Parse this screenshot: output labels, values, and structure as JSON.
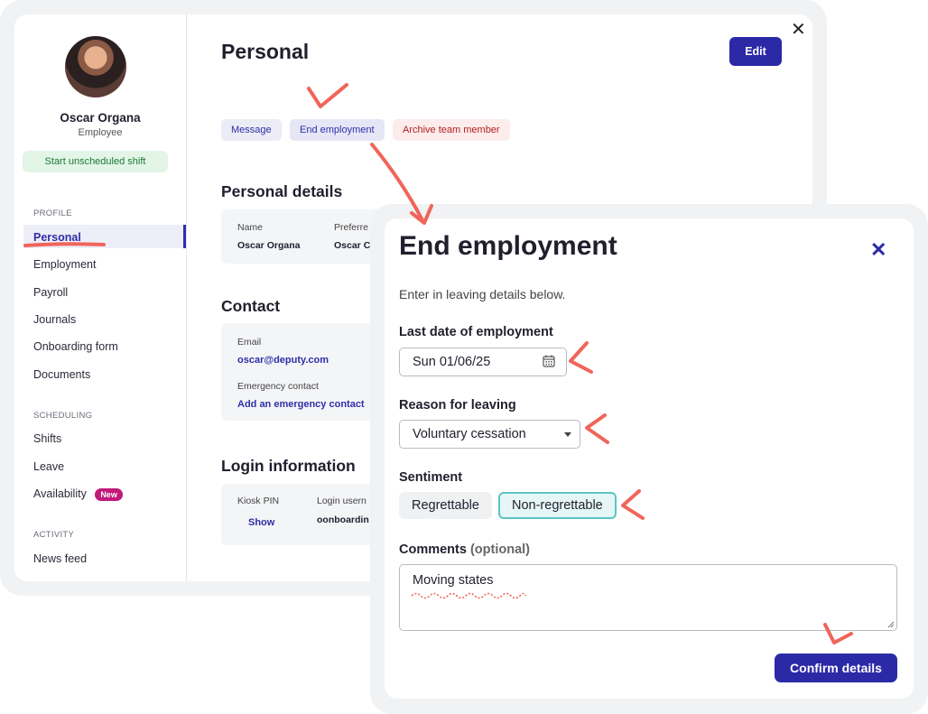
{
  "profile": {
    "name": "Oscar Organa",
    "role": "Employee",
    "start_shift_label": "Start unscheduled shift"
  },
  "sidebar": {
    "sections": {
      "profile": "PROFILE",
      "scheduling": "SCHEDULING",
      "activity": "ACTIVITY"
    },
    "items": {
      "personal": "Personal",
      "employment": "Employment",
      "payroll": "Payroll",
      "journals": "Journals",
      "onboarding": "Onboarding form",
      "documents": "Documents",
      "shifts": "Shifts",
      "leave": "Leave",
      "availability": "Availability",
      "availability_badge": "New",
      "news_feed": "News feed"
    }
  },
  "main": {
    "title": "Personal",
    "edit_label": "Edit",
    "close_glyph": "✕",
    "actions": {
      "message": "Message",
      "end_employment": "End employment",
      "archive": "Archive team member"
    },
    "personal_details": {
      "title": "Personal details",
      "name_label": "Name",
      "name_value": "Oscar Organa",
      "preferred_label": "Preferre",
      "preferred_value": "Oscar C"
    },
    "contact": {
      "title": "Contact",
      "email_label": "Email",
      "email_value": "oscar@deputy.com",
      "emergency_label": "Emergency contact",
      "emergency_link": "Add an emergency contact"
    },
    "login": {
      "title": "Login information",
      "kiosk_label": "Kiosk PIN",
      "kiosk_link": "Show",
      "username_label": "Login usern",
      "username_value": "oonboardin"
    }
  },
  "modal": {
    "title": "End employment",
    "close_glyph": "✕",
    "subtitle": "Enter in leaving details below.",
    "last_date_label": "Last date of employment",
    "last_date_value": "Sun 01/06/25",
    "reason_label": "Reason for leaving",
    "reason_value": "Voluntary cessation",
    "sentiment_label": "Sentiment",
    "sentiment_options": [
      "Regrettable",
      "Non-regrettable"
    ],
    "sentiment_selected": "Non-regrettable",
    "comments_label": "Comments",
    "comments_optional": "(optional)",
    "comments_value": "Moving states",
    "confirm_label": "Confirm details"
  },
  "colors": {
    "primary": "#2b29a6",
    "annotation": "#f0655a",
    "selected_border": "#5cc4c4",
    "danger_text": "#b41e1e",
    "success_bg": "#e3f5e6"
  },
  "icons": {
    "close": "close-icon",
    "calendar": "calendar-icon",
    "dropdown": "chevron-down-icon"
  }
}
